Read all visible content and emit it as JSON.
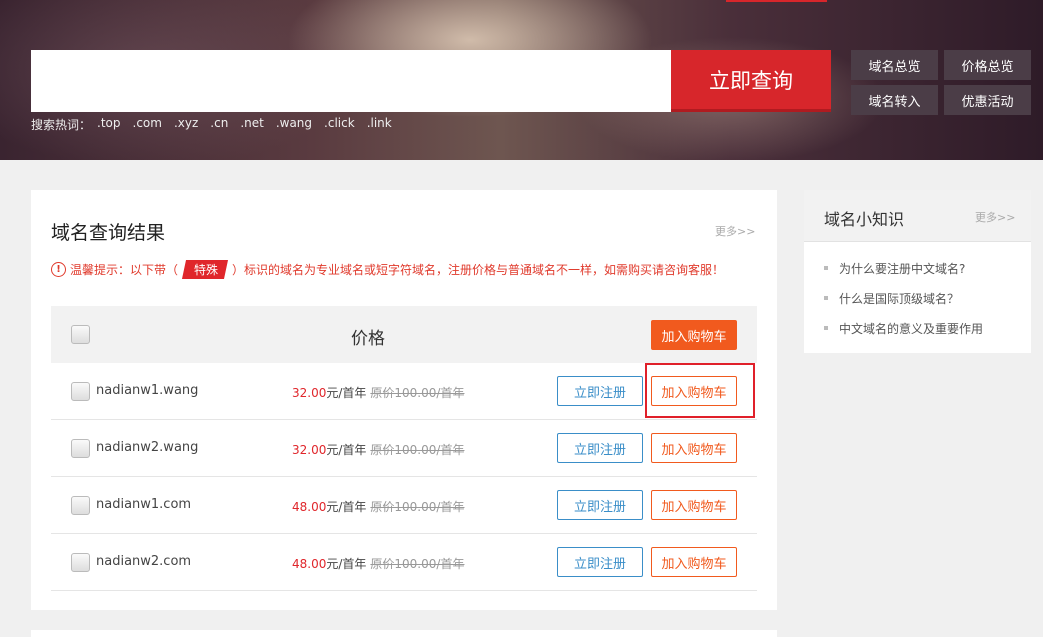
{
  "search": {
    "placeholder": "",
    "button_label": "立即查询",
    "hot_label": "搜索热词：",
    "hot_terms": [
      ".top",
      ".com",
      ".xyz",
      ".cn",
      ".net",
      ".wang",
      ".click",
      ".link"
    ]
  },
  "quick_links": [
    "域名总览",
    "价格总览",
    "域名转入",
    "优惠活动"
  ],
  "results": {
    "title": "域名查询结果",
    "more": "更多>>",
    "tip_prefix": "温馨提示：以下带（",
    "tip_badge": "特殊",
    "tip_suffix": "）标识的域名为专业域名或短字符域名，注册价格与普通域名不一样，如需购买请咨询客服！",
    "header_price": "价格",
    "header_add_cart": "加入购物车",
    "rows": [
      {
        "domain": "nadianw1.wang",
        "price": "32.00",
        "unit": "元/首年",
        "original": "原价100.00/首年",
        "register": "立即注册",
        "add_cart": "加入购物车"
      },
      {
        "domain": "nadianw2.wang",
        "price": "32.00",
        "unit": "元/首年",
        "original": "原价100.00/首年",
        "register": "立即注册",
        "add_cart": "加入购物车"
      },
      {
        "domain": "nadianw1.com",
        "price": "48.00",
        "unit": "元/首年",
        "original": "原价100.00/首年",
        "register": "立即注册",
        "add_cart": "加入购物车"
      },
      {
        "domain": "nadianw2.com",
        "price": "48.00",
        "unit": "元/首年",
        "original": "原价100.00/首年",
        "register": "立即注册",
        "add_cart": "加入购物车"
      }
    ]
  },
  "knowledge": {
    "title": "域名小知识",
    "more": "更多>>",
    "items": [
      "为什么要注册中文域名?",
      "什么是国际顶级域名？",
      "中文域名的意义及重要作用"
    ]
  },
  "colors": {
    "brand_red": "#d7262b",
    "orange": "#f15a1e",
    "blue": "#3a8ec8"
  }
}
